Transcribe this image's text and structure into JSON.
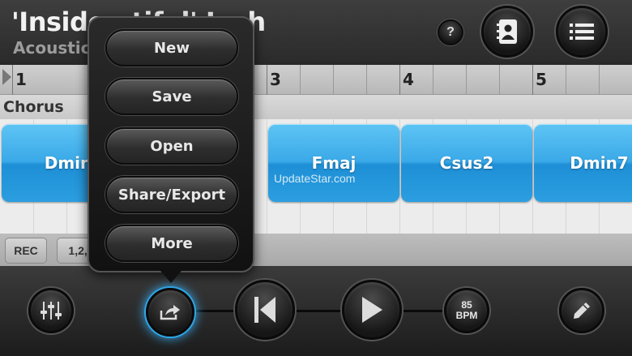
{
  "header": {
    "title": "'Inside          utiful' Josh",
    "subtitle": "Acoustic 1",
    "help_label": "?"
  },
  "ruler": {
    "bars": [
      "1",
      "3",
      "4",
      "5"
    ]
  },
  "section": {
    "label": "Chorus"
  },
  "chords": [
    {
      "name": "Dmin"
    },
    {
      "name": "Fmaj"
    },
    {
      "name": "Csus2"
    },
    {
      "name": "Dmin7"
    }
  ],
  "watermark": "UpdateStar.com",
  "strip": {
    "rec_label": "REC",
    "count_label": "1,2,3"
  },
  "transport": {
    "bpm_value": "85",
    "bpm_unit": "BPM"
  },
  "menu": {
    "items": [
      "New",
      "Save",
      "Open",
      "Share/Export",
      "More"
    ]
  },
  "colors": {
    "chord_blue": "#3aa9e8",
    "highlight_glow": "#2ea7e8"
  }
}
